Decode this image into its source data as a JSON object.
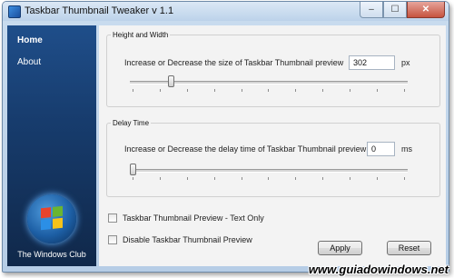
{
  "window": {
    "title": "Taskbar Thumbnail Tweaker v 1.1",
    "controls": [
      "–",
      "☐",
      "✕"
    ]
  },
  "sidebar": {
    "items": [
      {
        "label": "Home",
        "active": true
      },
      {
        "label": "About",
        "active": false
      }
    ],
    "footer": "The Windows Club",
    "logo_colors": [
      "#e8442c",
      "#6ab531",
      "#2b8fe6",
      "#f5c21a"
    ]
  },
  "height_width": {
    "legend": "Height and Width",
    "description": "Increase or Decrease the size of Taskbar Thumbnail preview",
    "value": "302",
    "unit": "px",
    "slider_level": 0.14
  },
  "delay_time": {
    "legend": "Delay Time",
    "description": "Increase or Decrease the delay time of Taskbar Thumbnail preview",
    "value": "0",
    "unit": "ms",
    "slider_level": 0.0
  },
  "options": [
    {
      "label": "Taskbar Thumbnail Preview - Text Only",
      "checked": false
    },
    {
      "label": "Disable Taskbar Thumbnail Preview",
      "checked": false
    }
  ],
  "buttons": {
    "apply": "Apply",
    "reset": "Reset"
  },
  "watermark": "www.guiadowindows.net"
}
